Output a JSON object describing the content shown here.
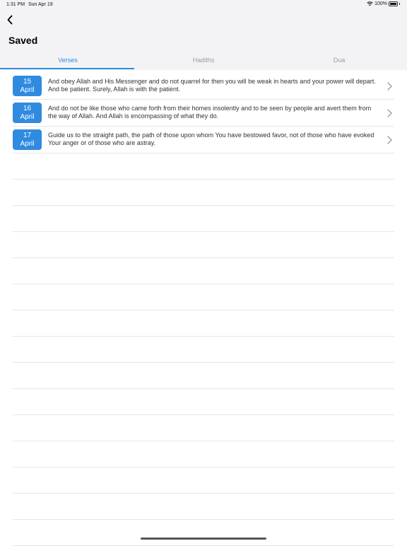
{
  "status_bar": {
    "time": "1:31 PM",
    "date": "Sun Apr 19",
    "battery": "100%"
  },
  "header": {
    "title": "Saved"
  },
  "tabs": [
    {
      "label": "Verses",
      "active": true
    },
    {
      "label": "Hadiths",
      "active": false
    },
    {
      "label": "Dua",
      "active": false
    }
  ],
  "items": [
    {
      "day": "15",
      "month": "April",
      "text": "And obey Allah and His Messenger and do not quarrel for then you will be weak in hearts and your power will depart. And be patient. Surely, Allah is with the patient."
    },
    {
      "day": "16",
      "month": "April",
      "text": "And do not be like those who came forth from their homes insolently and to be seen by people and avert them from the way of Allah. And Allah is encompassing of what they do."
    },
    {
      "day": "17",
      "month": "April",
      "text": "Guide us to the straight path, the path of those upon whom You have bestowed favor, not of those who have evoked Your anger or of those who are astray."
    }
  ],
  "colors": {
    "accent": "#2f8be0",
    "header_bg": "#f3f3f6",
    "inactive_tab": "#9b9b9f"
  },
  "icons": {
    "back": "chevron-left-icon",
    "row": "chevron-right-icon",
    "wifi": "wifi-icon",
    "battery": "battery-icon"
  }
}
